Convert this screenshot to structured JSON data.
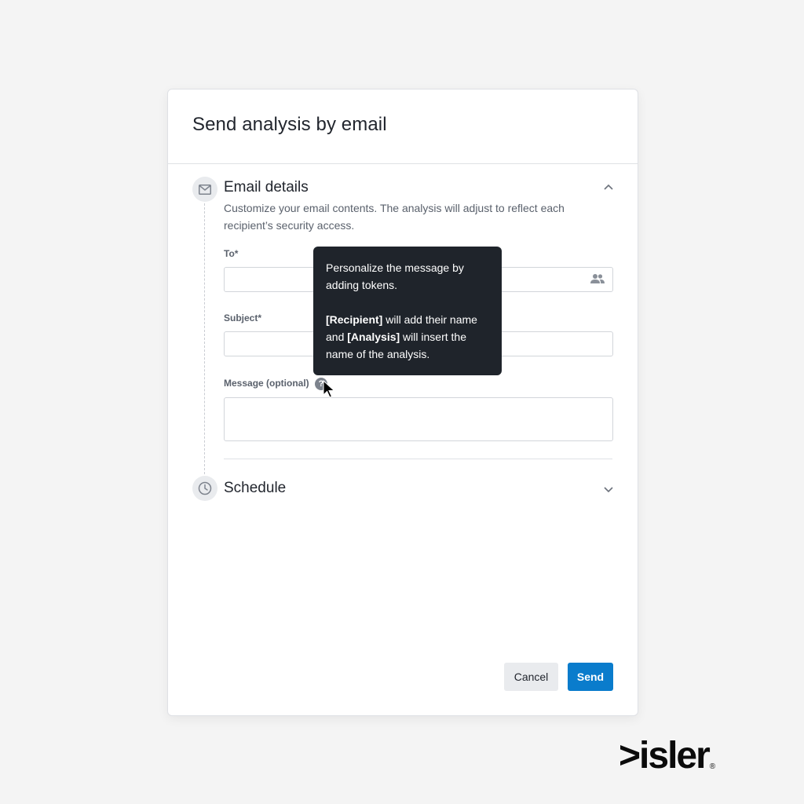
{
  "dialog": {
    "title": "Send analysis by email"
  },
  "email_section": {
    "title": "Email details",
    "icon": "mail-icon",
    "expanded": true,
    "description": "Customize your email contents. The analysis will adjust to reflect each recipient’s security access.",
    "to": {
      "label": "To*",
      "value": "",
      "icon": "people-icon"
    },
    "subject": {
      "label": "Subject*",
      "value": ""
    },
    "message": {
      "label": "Message (optional)",
      "value": "",
      "help_icon": "help-icon"
    }
  },
  "tooltip": {
    "line1": "Personalize the message by adding tokens.",
    "token_recipient": "[Recipient]",
    "text_after_recipient": " will add their name and ",
    "token_analysis": "[Analysis]",
    "text_after_analysis": " will insert the name of the analysis."
  },
  "schedule_section": {
    "title": "Schedule",
    "icon": "clock-icon",
    "expanded": false
  },
  "footer": {
    "cancel_label": "Cancel",
    "send_label": "Send"
  },
  "brand": {
    "name": ">isler",
    "registered": "®"
  },
  "colors": {
    "primary": "#0a7ccc",
    "tooltip_bg": "#1f242b",
    "page_bg": "#f4f4f4"
  }
}
